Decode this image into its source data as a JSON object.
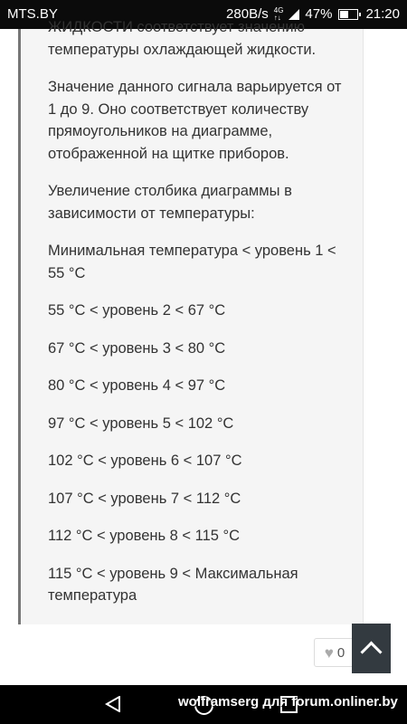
{
  "status_bar": {
    "carrier": "MTS.BY",
    "speed": "280B/s",
    "network": [
      "4G",
      "↑↓"
    ],
    "battery": "47%",
    "battery_level": 0.47,
    "time": "21:20"
  },
  "post": {
    "paragraphs": [
      "ЖИДКОСТИ соответствует значению температуры охлаждающей жидкости.",
      "Значение данного сигнала варьируется от 1 до 9. Оно соответствует количеству прямоугольников на диаграмме, отображенной на щитке приборов.",
      "Увеличение столбика диаграммы в зависимости от температуры:"
    ],
    "levels": [
      "Минимальная температура < уровень 1 < 55 °C",
      "55 °C < уровень 2 < 67 °C",
      "67 °C < уровень 3 < 80 °C",
      "80 °C < уровень 4 < 97 °C",
      "97 °C < уровень 5 < 102 °C",
      "102 °C < уровень 6 < 107 °C",
      "107 °C < уровень 7 < 112 °C",
      "112 °C < уровень 8 < 115 °C",
      "115 °C < уровень 9 < Максимальная температура"
    ]
  },
  "like": {
    "icon": "heart-icon",
    "count": "0"
  },
  "scroll_top": {
    "icon": "chevron-up-icon"
  },
  "watermark": "wolframserg для forum.onliner.by"
}
